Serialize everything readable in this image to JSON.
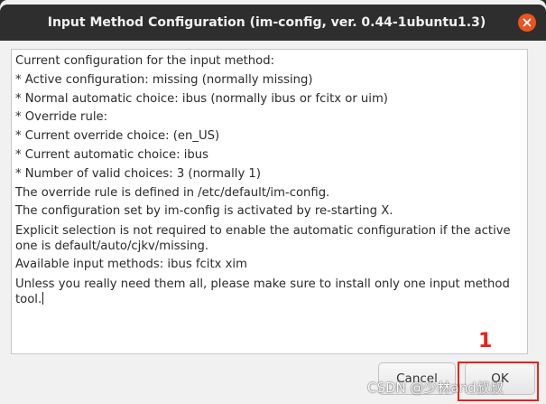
{
  "window": {
    "title": "Input Method Configuration (im-config, ver. 0.44-1ubuntu1.3)",
    "close_icon": "close-icon",
    "close_color": "#e95420"
  },
  "message": {
    "lines": [
      "Current configuration for the input method:",
      " * Active configuration: missing (normally missing)",
      " * Normal automatic choice: ibus (normally ibus or fcitx or uim)",
      " * Override rule:",
      " * Current override choice:  (en_US)",
      " * Current automatic choice: ibus",
      " * Number of valid choices: 3 (normally 1)",
      "The override rule is defined in /etc/default/im-config.",
      "The configuration set by im-config is activated by re-starting X.",
      "Explicit selection is not required to enable the automatic configuration if the active one is default/auto/cjkv/missing.",
      "  Available input methods: ibus fcitx xim",
      "Unless you really need them all, please make sure to install only one input method tool."
    ]
  },
  "buttons": {
    "cancel_label": "Cancel",
    "ok_label": "OK"
  },
  "annotation": {
    "number": "1",
    "color": "#e8231a"
  },
  "watermark": {
    "text": "CSDN @少林and叔叔"
  }
}
